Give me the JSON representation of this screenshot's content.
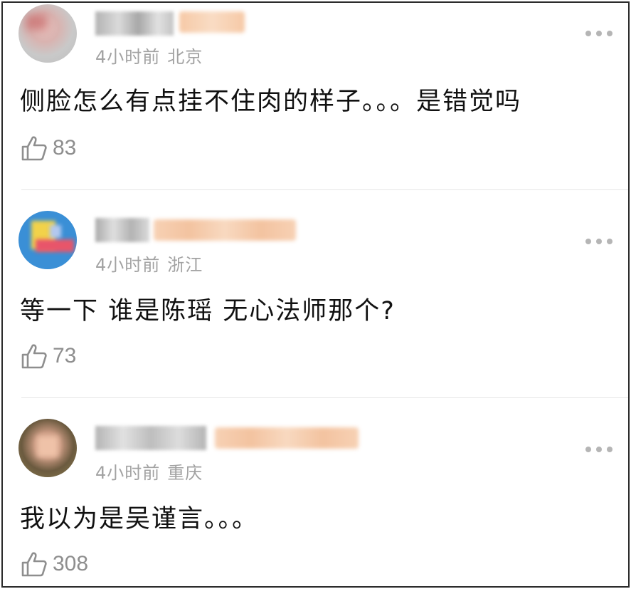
{
  "comments": [
    {
      "time": "4小时前",
      "location": "北京",
      "text": "侧脸怎么有点挂不住肉的样子。。。是错觉吗",
      "likes": "83",
      "icon": "thumbs-up-icon"
    },
    {
      "time": "4小时前",
      "location": "浙江",
      "text": "等一下 谁是陈瑶 无心法师那个?",
      "likes": "73",
      "icon": "thumbs-up-icon"
    },
    {
      "time": "4小时前",
      "location": "重庆",
      "text": "我以为是吴谨言。。。",
      "likes": "308",
      "icon": "thumbs-up-icon"
    }
  ],
  "colors": {
    "meta": "#a2a2a2",
    "text": "#111111",
    "likes": "#8e8e8e",
    "divider": "#e6e6e6"
  }
}
